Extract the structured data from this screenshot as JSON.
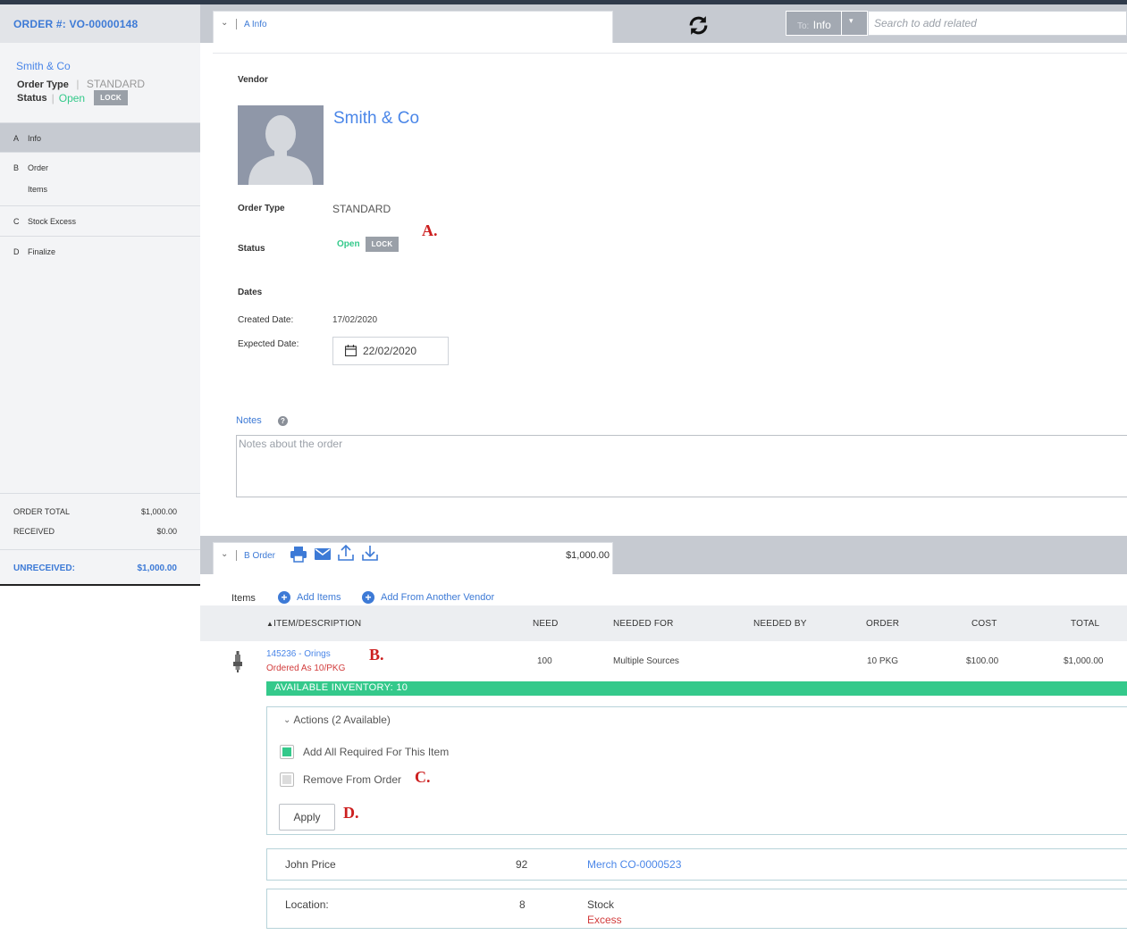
{
  "sidebar": {
    "order_number": "ORDER #: VO-00000148",
    "vendor": "Smith & Co",
    "order_type_label": "Order Type",
    "order_type_sep": "|",
    "order_type_value": "STANDARD",
    "status_label": "Status",
    "status_sep": "|",
    "status_value": "Open",
    "lock_label": "LOCK",
    "nav": [
      {
        "letter": "A",
        "label": "Info"
      },
      {
        "letter": "B",
        "label": "Order",
        "sub": "Items"
      },
      {
        "letter": "C",
        "label": "Stock Excess"
      },
      {
        "letter": "D",
        "label": "Finalize"
      }
    ],
    "totals": {
      "order_total_label": "ORDER TOTAL",
      "order_total_value": "$1,000.00",
      "received_label": "RECEIVED",
      "received_value": "$0.00",
      "unreceived_label": "UNRECEIVED:",
      "unreceived_value": "$1,000.00"
    }
  },
  "header": {
    "section_a_tab": "A Info",
    "to_prefix": "To:",
    "to_value": "Info",
    "search_placeholder": "Search to add related"
  },
  "info": {
    "vendor_label": "Vendor",
    "vendor_name": "Smith & Co",
    "order_type_label": "Order Type",
    "order_type_value": "STANDARD",
    "status_label": "Status",
    "status_value": "Open",
    "lock_label": "LOCK",
    "dates_label": "Dates",
    "created_label": "Created Date:",
    "created_value": "17/02/2020",
    "expected_label": "Expected Date:",
    "expected_value": "22/02/2020",
    "notes_label": "Notes",
    "notes_help": "?",
    "notes_placeholder": "Notes about the order"
  },
  "annotations": {
    "a": "A.",
    "b": "B.",
    "c": "C.",
    "d": "D."
  },
  "order": {
    "section_b_tab": "B Order",
    "total": "$1,000.00",
    "items_label": "Items",
    "add_items": "Add Items",
    "add_from_vendor": "Add From Another Vendor",
    "columns": [
      "ITEM/DESCRIPTION",
      "NEED",
      "NEEDED FOR",
      "NEEDED BY",
      "ORDER",
      "COST",
      "TOTAL"
    ],
    "item": {
      "code": "145236 - Orings",
      "ordered_as": "Ordered As 10/PKG",
      "need": "100",
      "needed_for": "Multiple Sources",
      "needed_by": "",
      "order": "10 PKG",
      "cost": "$100.00",
      "total": "$1,000.00"
    },
    "inventory_banner": "AVAILABLE INVENTORY: 10",
    "actions": {
      "title": "Actions (2 Available)",
      "option1": "Add All Required For This Item",
      "option1_checked": true,
      "option2": "Remove From Order",
      "option2_checked": false,
      "apply": "Apply"
    },
    "sources": [
      {
        "name": "John Price",
        "qty": "92",
        "ref": "Merch CO-0000523",
        "ref_sub": ""
      },
      {
        "name": "Location:",
        "qty": "8",
        "ref": "Stock",
        "ref_sub": "Excess"
      }
    ]
  },
  "colors": {
    "accent_blue": "#3d7ad6",
    "status_green": "#34c98b",
    "error_red": "#d23c3c",
    "annotation_red": "#cc1f1f"
  }
}
